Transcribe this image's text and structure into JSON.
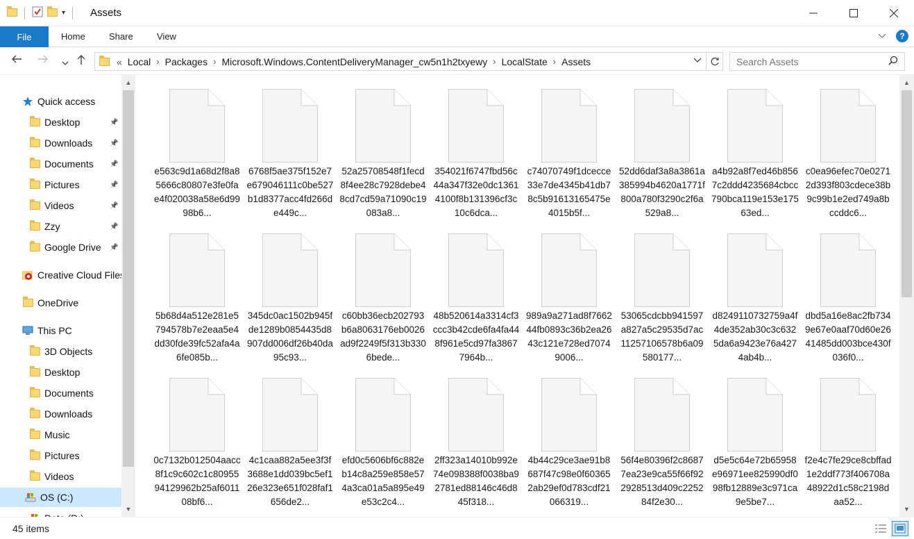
{
  "window": {
    "title": "Assets"
  },
  "ribbon": {
    "tabs": [
      "File",
      "Home",
      "Share",
      "View"
    ]
  },
  "address": {
    "overflow": "«",
    "crumbs": [
      "Local",
      "Packages",
      "Microsoft.Windows.ContentDeliveryManager_cw5n1h2txyewy",
      "LocalState",
      "Assets"
    ]
  },
  "search": {
    "placeholder": "Search Assets"
  },
  "nav": {
    "items": [
      {
        "label": "Quick access",
        "icon": "star-icon"
      },
      {
        "label": "Desktop",
        "icon": "folder-icon",
        "pinned": true
      },
      {
        "label": "Downloads",
        "icon": "folder-icon",
        "pinned": true
      },
      {
        "label": "Documents",
        "icon": "folder-icon",
        "pinned": true
      },
      {
        "label": "Pictures",
        "icon": "folder-icon",
        "pinned": true
      },
      {
        "label": "Videos",
        "icon": "folder-icon",
        "pinned": true
      },
      {
        "label": "Zzy",
        "icon": "folder-icon",
        "pinned": true
      },
      {
        "label": "Google Drive",
        "icon": "folder-icon",
        "pinned": true
      },
      {
        "label": "Creative Cloud Files",
        "icon": "creative-cloud-icon"
      },
      {
        "label": "OneDrive",
        "icon": "folder-icon"
      },
      {
        "label": "This PC",
        "icon": "computer-icon"
      },
      {
        "label": "3D Objects",
        "icon": "folder-icon"
      },
      {
        "label": "Desktop",
        "icon": "folder-icon"
      },
      {
        "label": "Documents",
        "icon": "folder-icon"
      },
      {
        "label": "Downloads",
        "icon": "folder-icon"
      },
      {
        "label": "Music",
        "icon": "folder-icon"
      },
      {
        "label": "Pictures",
        "icon": "folder-icon"
      },
      {
        "label": "Videos",
        "icon": "folder-icon"
      },
      {
        "label": "OS (C:)",
        "icon": "drive-icon",
        "selected": true
      },
      {
        "label": "Data (D:)",
        "icon": "drive-icon"
      }
    ]
  },
  "files": [
    "e563c9d1a68d2f8a85666c80807e3fe0fae4f020038a58e6d9998b6...",
    "6768f5ae375f152e7e679046111c0be527b1d8377acc4fd266de449c...",
    "52a25708548f1fecd8f4ee28c7928debe48cd7cd59a71090c19083a8...",
    "354021f6747fbd56c44a347f32e0dc13614100f8b131396cf3c10c6dca...",
    "c74070749f1dcecce33e7de4345b41db78c5b91613165475e4015b5f...",
    "52dd6daf3a8a3861a385994b4620a1771f800a780f3290c2f6a529a8...",
    "a4b92a8f7ed46b8567c2ddd4235684cbcc790bca119e153e17563ed...",
    "c0ea96efec70e02712d393f803cdece38b9c99b1e2ed749a8bccddc6...",
    "5b68d4a512e281e5794578b7e2eaa5e4dd30fde39fc52afa4a6fe085b...",
    "345dc0ac1502b945fde1289b0854435d8907dd006df26b40da95c93...",
    "c60bb36ecb202793b6a8063176eb0026ad9f2249f5f313b3306bede...",
    "48b520614a3314cf3ccc3b42cde6fa4fa448f961e5cd97fa38677964b...",
    "989a9a271ad8f766244fb0893c36b2ea2643c121e728ed70749006...",
    "53065cdcbb941597a827a5c29535d7ac11257106578b6a09580177...",
    "d8249110732759a4f4de352ab30c3c6325da6a9423e76a4274ab4b...",
    "dbd5a16e8ac2fb7349e67e0aaf70d60e2641485dd003bce430f036f0...",
    "0c7132b012504aacc8f1c9c602c1c8095594129962b25af601108bf6...",
    "4c1caa882a5ee3f3f3688e1dd039bc5ef126e323e651f028faf1656de2...",
    "efd0c5606bf6c882eb14c8a259e858e574a3ca01a5a895e49e53c2c4...",
    "2ff323a14010b992e74e098388f0038ba92781ed88146c46d845f318...",
    "4b44c29ce3ae91b8687f47c98e0f603652ab29ef0d783cdf21066319...",
    "56f4e80396f2c86877ea23e9ca55f66f922928513d409c225284f2e30...",
    "d5e5c64e72b65958e96971ee825990df098fb12889e3c971ca9e5be7...",
    "f2e4c7fe29ce8cbffad1e2ddf773f406708a48922d1c58c2198daa52..."
  ],
  "status": {
    "items_count": "45 items"
  }
}
